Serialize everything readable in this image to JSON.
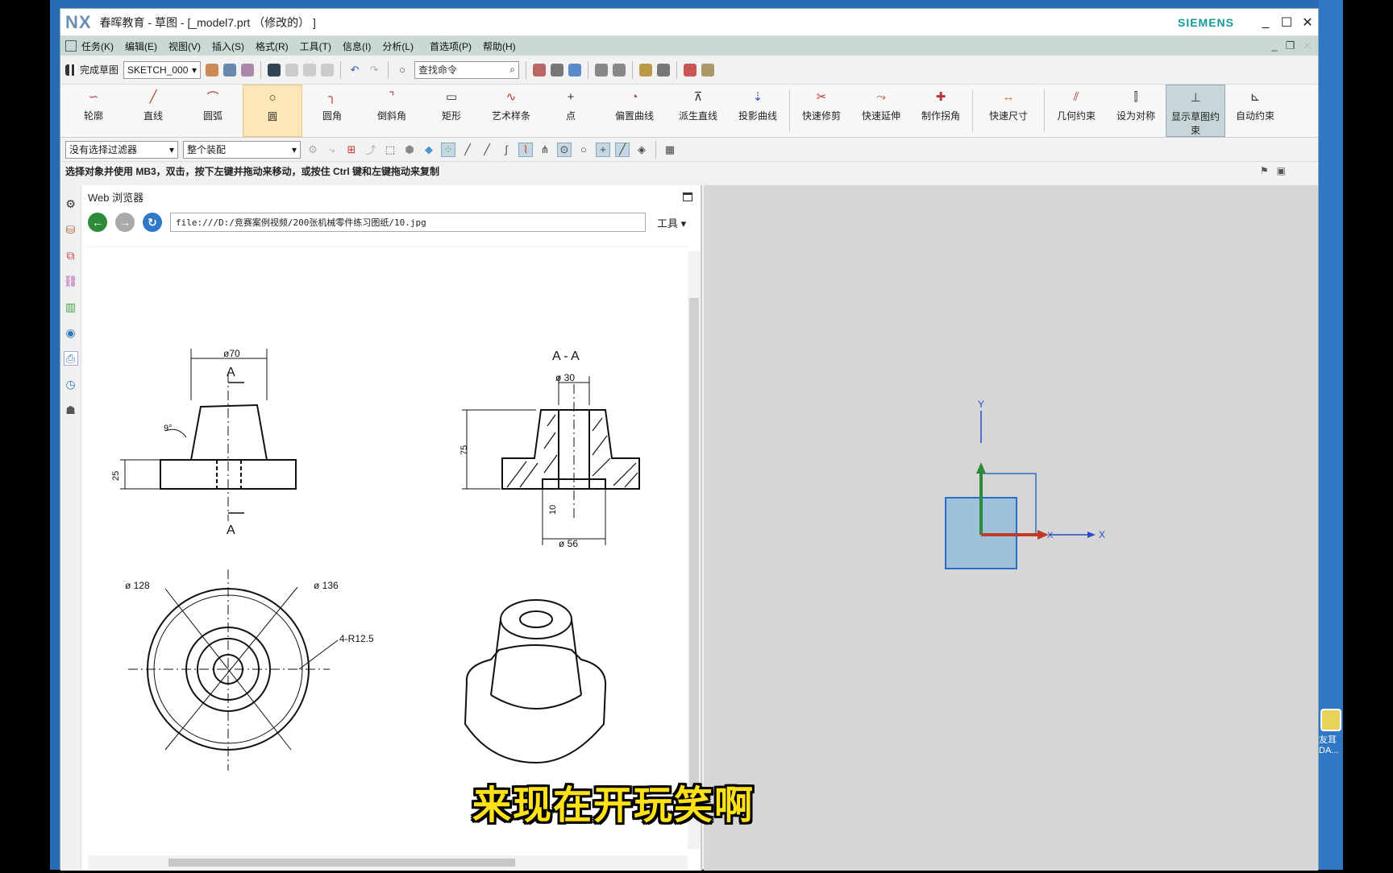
{
  "titlebar": {
    "logo": "NX",
    "title": "春晖教育 - 草图 - [_model7.prt （修改的） ]",
    "brand": "SIEMENS",
    "min": "_",
    "max": "☐",
    "close": "✕"
  },
  "menu": {
    "items": [
      "任务(K)",
      "编辑(E)",
      "视图(V)",
      "插入(S)",
      "格式(R)",
      "工具(T)",
      "信息(I)",
      "分析(L)",
      "首选项(P)",
      "帮助(H)"
    ]
  },
  "toolbar1": {
    "finish_sketch": "完成草图",
    "sketch_name": "SKETCH_000",
    "search_placeholder": "查找命令"
  },
  "ribbon": {
    "items": [
      {
        "label": "轮廓"
      },
      {
        "label": "直线"
      },
      {
        "label": "圆弧"
      },
      {
        "label": "圆"
      },
      {
        "label": "圆角"
      },
      {
        "label": "倒斜角"
      },
      {
        "label": "矩形"
      },
      {
        "label": "艺术样条"
      },
      {
        "label": "点"
      },
      {
        "label": "偏置曲线"
      },
      {
        "label": "派生直线"
      },
      {
        "label": "投影曲线"
      },
      {
        "label": "快速修剪"
      },
      {
        "label": "快速延伸"
      },
      {
        "label": "制作拐角"
      },
      {
        "label": "快速尺寸"
      },
      {
        "label": "几何约束"
      },
      {
        "label": "设为对称"
      },
      {
        "label": "显示草图约束"
      },
      {
        "label": "自动约束"
      }
    ]
  },
  "toolbar2": {
    "filter": "没有选择过滤器",
    "scope": "整个装配"
  },
  "status": {
    "message": "选择对象并使用 MB3，双击，按下左键并拖动来移动，或按住 Ctrl 键和左键拖动来复制"
  },
  "web": {
    "title": "Web 浏览器",
    "url": "file:///D:/竞赛案例视频/200张机械零件练习图纸/10.jpg",
    "tools": "工具"
  },
  "drawing": {
    "dim_d70": "ø70",
    "section_a": "A",
    "section_aa": "A - A",
    "dim_d30": "ø 30",
    "dim_75": "75",
    "dim_25": "25",
    "dim_10": "10",
    "dim_d56": "ø 56",
    "angle_9": "9°",
    "dim_d128": "ø 128",
    "dim_d136": "ø 136",
    "dim_r12": "4-R12.5"
  },
  "viewport": {
    "axis_x": "X",
    "axis_y": "Y"
  },
  "desktop": {
    "icon_label": "友耳\nDA..."
  },
  "subtitle": "来现在开玩笑啊",
  "colors": {
    "menubar": "#c9d9d6",
    "viewport": "#d6d6d6",
    "subtitle": "#ffe11a"
  }
}
